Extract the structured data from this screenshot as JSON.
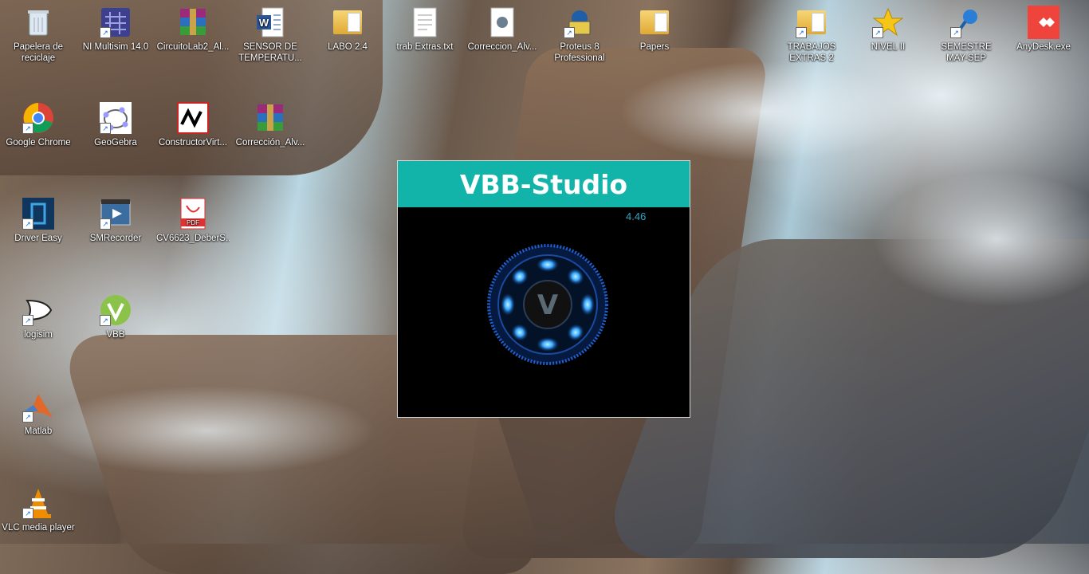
{
  "desktop": {
    "icons": [
      {
        "label": "Papelera de\nreciclaje",
        "icon": "recycle-bin-icon"
      },
      {
        "label": "NI Multisim 14.0",
        "icon": "multisim-icon"
      },
      {
        "label": "CircuitoLab2_Al...",
        "icon": "winrar-icon"
      },
      {
        "label": "SENSOR DE\nTEMPERATU...",
        "icon": "word-document-icon"
      },
      {
        "label": "LABO 2.4",
        "icon": "folder-icon"
      },
      {
        "label": "trab Extras.txt",
        "icon": "text-file-icon"
      },
      {
        "label": "Correccion_Alv...",
        "icon": "file-icon"
      },
      {
        "label": "Proteus 8\nProfessional",
        "icon": "proteus-icon"
      },
      {
        "label": "Papers",
        "icon": "folder-icon"
      },
      {
        "label": "TRABAJOS\nEXTRAS 2",
        "icon": "folder-shortcut-icon"
      },
      {
        "label": "NIVEL II",
        "icon": "star-icon"
      },
      {
        "label": "SEMESTRE\nMAY-SEP",
        "icon": "pin-icon"
      },
      {
        "label": "AnyDesk.exe",
        "icon": "anydesk-icon"
      },
      {
        "label": "Google Chrome",
        "icon": "chrome-icon"
      },
      {
        "label": "GeoGebra",
        "icon": "geogebra-icon"
      },
      {
        "label": "ConstructorVirt...",
        "icon": "constructor-icon"
      },
      {
        "label": "Corrección_Alv...",
        "icon": "winrar-icon"
      },
      {
        "label": "Driver Easy",
        "icon": "driver-easy-icon"
      },
      {
        "label": "SMRecorder",
        "icon": "smrecorder-icon"
      },
      {
        "label": "CV6623_DeberS...",
        "icon": "pdf-icon"
      },
      {
        "label": "logisim",
        "icon": "logisim-icon"
      },
      {
        "label": "VBB",
        "icon": "vbb-icon"
      },
      {
        "label": "Matlab",
        "icon": "matlab-icon"
      },
      {
        "label": "VLC media player",
        "icon": "vlc-icon"
      }
    ]
  },
  "splash": {
    "title": "VBB-Studio",
    "version": "4.46",
    "logo_letter": "V",
    "accent": "#12b4aa"
  }
}
